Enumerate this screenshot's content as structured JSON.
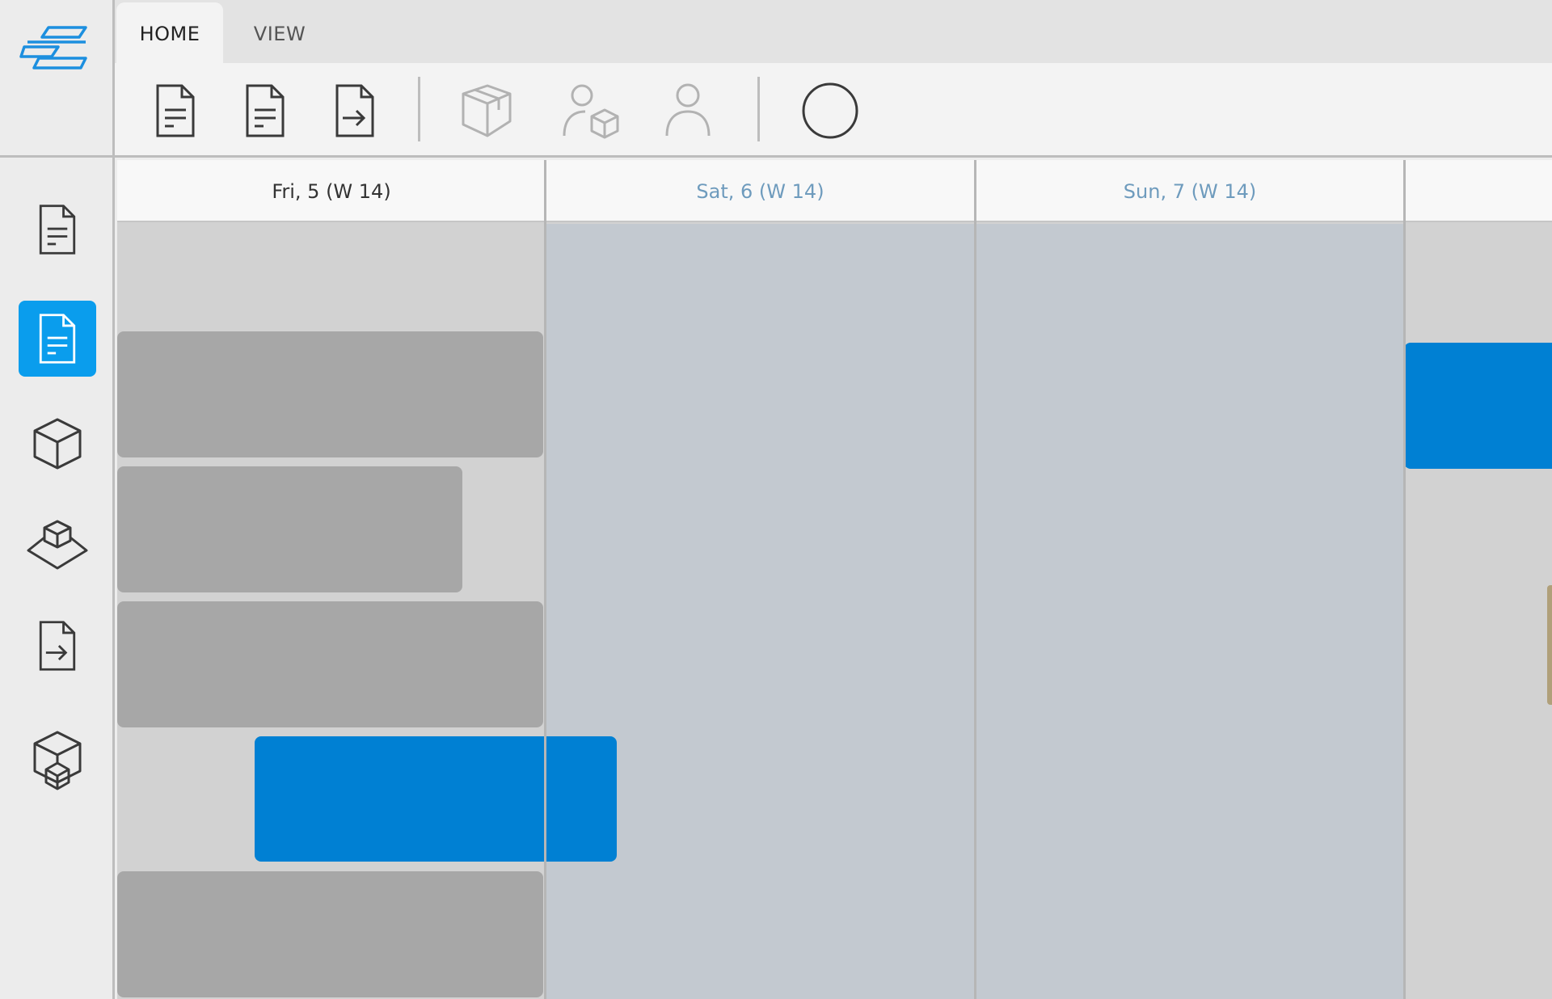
{
  "tabs": [
    {
      "label": "HOME",
      "active": true
    },
    {
      "label": "VIEW",
      "active": false
    }
  ],
  "toolbar": {
    "icons": [
      "document-icon",
      "document-icon",
      "document-export-icon",
      "package-icon",
      "user-package-icon",
      "user-icon",
      "circle-icon"
    ]
  },
  "sidebar": {
    "items": [
      {
        "icon": "document-icon",
        "active": false
      },
      {
        "icon": "document-icon",
        "active": true
      },
      {
        "icon": "cube-icon",
        "active": false
      },
      {
        "icon": "cube-on-platform-icon",
        "active": false
      },
      {
        "icon": "document-export-icon",
        "active": false
      },
      {
        "icon": "stacked-cubes-icon",
        "active": false
      }
    ]
  },
  "calendar": {
    "days": [
      {
        "label": "Fri, 5 (W 14)",
        "weekend": false
      },
      {
        "label": "Sat, 6 (W 14)",
        "weekend": true
      },
      {
        "label": "Sun, 7 (W 14)",
        "weekend": true
      }
    ]
  },
  "colors": {
    "accent": "#0080d3",
    "active_nav": "#0a9ded",
    "bar_gray": "#a7a7a7",
    "weekend_bg": "#c3c9d0",
    "weekend_text": "#6e9bbd"
  }
}
